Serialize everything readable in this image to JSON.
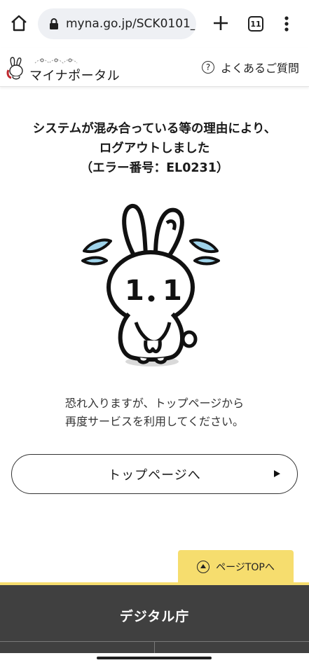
{
  "browser": {
    "url": "myna.go.jp/SCK0101_",
    "tab_count": "11"
  },
  "header": {
    "logo_text": "マイナポータル",
    "faq_icon": "?",
    "faq_label": "よくあるご質問"
  },
  "main": {
    "title_lines": [
      "システムが混み合っている等の理由により、",
      "ログアウトしました",
      "（エラー番号：EL0231）"
    ],
    "mascot_badge": "1 . 1",
    "message_lines": [
      "恐れ入りますが、トップページから",
      "再度サービスを利用してください。"
    ],
    "top_link_label": "トップページへ"
  },
  "page_top": {
    "label": "ページTOPへ"
  },
  "footer": {
    "title": "デジタル庁"
  },
  "colors": {
    "accent_yellow": "#f6dd6e",
    "footer_bg": "#404040",
    "url_pill_bg": "#eef0f4"
  }
}
